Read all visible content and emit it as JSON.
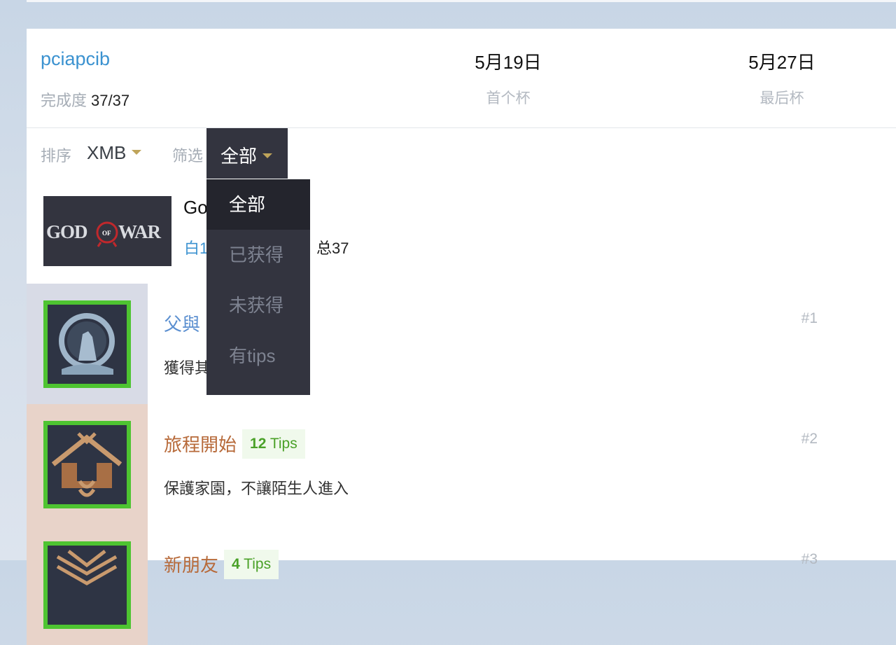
{
  "header": {
    "username": "pciapcib",
    "progress_label": "完成度",
    "progress_value": "37/37",
    "first_cup_date": "5月19日",
    "first_cup_label": "首个杯",
    "last_cup_date": "5月27日",
    "last_cup_label": "最后杯"
  },
  "filterbar": {
    "sort_label": "排序",
    "sort_value": "XMB",
    "filter_label": "筛选",
    "filter_value": "全部"
  },
  "dropdown": {
    "options": [
      "全部",
      "已获得",
      "未获得",
      "有tips"
    ],
    "selected": "全部"
  },
  "game": {
    "title_visible": "Go",
    "cover_logo_text": "GOD OF WAR",
    "subtitle_visible": "白1",
    "total": "总37"
  },
  "trophies": [
    {
      "name": "父與",
      "description": "獲得其",
      "index": "#1",
      "tips": "",
      "rarity_color": "#d8dbe6",
      "name_color": "#5b8fd0"
    },
    {
      "name": "旅程開始",
      "tips_count": "12",
      "tips_label": "Tips",
      "description": "保護家園，不讓陌生人進入",
      "index": "#2",
      "rarity_color": "#e8d3c9",
      "name_color": "#b76a3a"
    },
    {
      "name": "新朋友",
      "tips_count": "4",
      "tips_label": "Tips",
      "description": "",
      "index": "#3",
      "rarity_color": "#e8d3c9",
      "name_color": "#b76a3a"
    }
  ],
  "colors": {
    "accent_blue": "#3b92d0",
    "trophy_border_green": "#4ec431",
    "dropdown_bg": "#33343f",
    "caret_gold": "#bfa45a"
  }
}
